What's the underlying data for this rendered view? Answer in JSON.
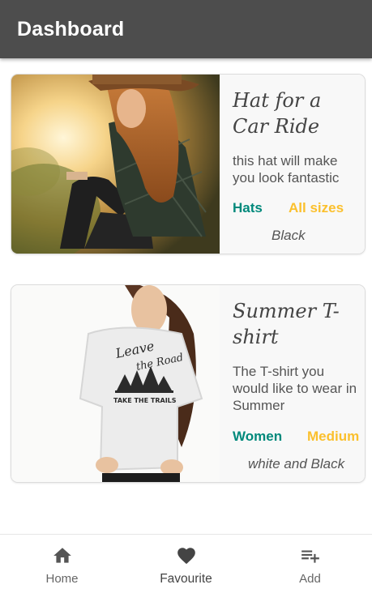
{
  "appbar": {
    "title": "Dashboard"
  },
  "products": [
    {
      "title": "Hat for a Car Ride",
      "description": "this hat will make you look fantastic",
      "category": "Hats",
      "size": "All sizes",
      "color": "Black",
      "image": "woman-in-hat-photo"
    },
    {
      "title": "Summer T-shirt",
      "description": "The T-shirt you would like to wear in Summer",
      "category": "Women",
      "size": "Medium",
      "color": "white and Black",
      "image": "woman-in-tshirt-photo"
    }
  ],
  "bottom_nav": {
    "active": "Favourite",
    "items": [
      {
        "label": "Home",
        "icon": "home-icon"
      },
      {
        "label": "Favourite",
        "icon": "heart-icon"
      },
      {
        "label": "Add",
        "icon": "playlist-add-icon"
      }
    ]
  },
  "colors": {
    "appbar": "#4d4d4d",
    "category": "#00897b",
    "size": "#fbc02d"
  }
}
